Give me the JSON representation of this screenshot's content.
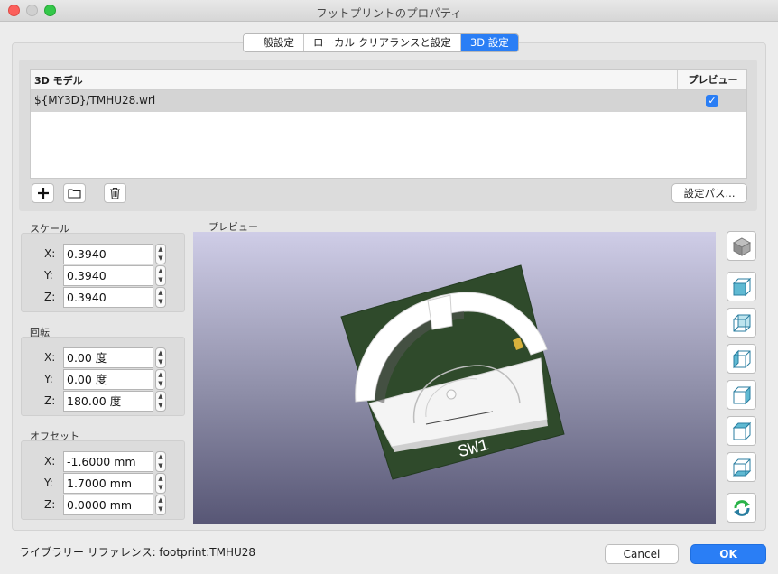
{
  "window": {
    "title": "フットプリントのプロパティ"
  },
  "tabs": [
    {
      "label": "一般設定",
      "active": false
    },
    {
      "label": "ローカル クリアランスと設定",
      "active": false
    },
    {
      "label": "3D 設定",
      "active": true
    }
  ],
  "models_table": {
    "headers": {
      "model": "3D モデル",
      "preview": "プレビュー"
    },
    "rows": [
      {
        "path": "${MY3D}/TMHU28.wrl",
        "preview_checked": true
      }
    ]
  },
  "model_toolbar": {
    "add_icon": "plus-icon",
    "browse_icon": "folder-icon",
    "remove_icon": "trash-icon",
    "config_paths_label": "設定パス..."
  },
  "scale": {
    "title": "スケール",
    "x_label": "X:",
    "x": "0.3940",
    "y_label": "Y:",
    "y": "0.3940",
    "z_label": "Z:",
    "z": "0.3940"
  },
  "rotation": {
    "title": "回転",
    "x_label": "X:",
    "x": "0.00 度",
    "y_label": "Y:",
    "y": "0.00 度",
    "z_label": "Z:",
    "z": "180.00 度"
  },
  "offset": {
    "title": "オフセット",
    "x_label": "X:",
    "x": "-1.6000 mm",
    "y_label": "Y:",
    "y": "1.7000 mm",
    "z_label": "Z:",
    "z": "0.0000 mm"
  },
  "preview": {
    "title": "プレビュー",
    "silkscreen_ref": "SW1",
    "board_color": "#2f4a2b",
    "background_top": "#cfcde7",
    "background_bottom": "#575675"
  },
  "view_buttons": [
    "cube-iso-icon",
    "view-front-icon",
    "view-back-icon",
    "view-left-icon",
    "view-right-icon",
    "view-top-icon",
    "view-bottom-icon",
    "reload-icon"
  ],
  "footer": {
    "library_reference": "ライブラリー リファレンス:  footprint:TMHU28",
    "cancel_label": "Cancel",
    "ok_label": "OK"
  },
  "colors": {
    "accent": "#2a7ef5"
  }
}
